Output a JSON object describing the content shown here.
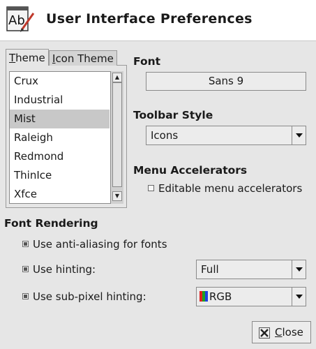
{
  "window": {
    "title": "User Interface Preferences"
  },
  "tabs": [
    {
      "label": "Theme",
      "mnemonic": "T"
    },
    {
      "label": "Icon Theme",
      "mnemonic": "I"
    }
  ],
  "theme_list": {
    "items": [
      "Crux",
      "Industrial",
      "Mist",
      "Raleigh",
      "Redmond",
      "ThinIce",
      "Xfce"
    ],
    "selected": "Mist"
  },
  "font": {
    "heading": "Font",
    "value": "Sans 9"
  },
  "toolbar": {
    "heading": "Toolbar Style",
    "value": "Icons"
  },
  "accelerators": {
    "heading": "Menu Accelerators",
    "checkbox_label": "Editable menu accelerators",
    "checked": false
  },
  "rendering": {
    "heading": "Font Rendering",
    "antialias_label": "Use anti-aliasing for fonts",
    "antialias_checked": true,
    "hinting_label": "Use hinting:",
    "hinting_checked": true,
    "hinting_value": "Full",
    "subpixel_label": "Use sub-pixel hinting:",
    "subpixel_checked": true,
    "subpixel_value": "RGB"
  },
  "footer": {
    "close_label": "Close",
    "close_mnemonic": "C"
  },
  "colors": {
    "selection": "#c8c8c8",
    "rgb_red": "#e02020",
    "rgb_green": "#20a020",
    "rgb_blue": "#2040e0"
  }
}
